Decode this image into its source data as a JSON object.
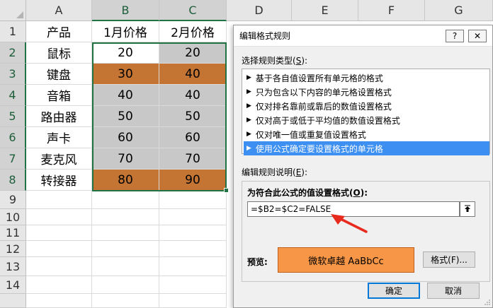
{
  "sheet": {
    "columns": [
      "A",
      "B",
      "C",
      "D",
      "E",
      "F",
      "G"
    ],
    "rows": [
      "1",
      "2",
      "3",
      "4",
      "5",
      "6",
      "7",
      "8",
      "9",
      "10",
      "11",
      "12",
      "13",
      "14"
    ],
    "header_row": [
      "产品",
      "1月价格",
      "2月价格"
    ],
    "data": [
      {
        "name": "鼠标",
        "jan": "20",
        "feb": "20"
      },
      {
        "name": "键盘",
        "jan": "30",
        "feb": "40"
      },
      {
        "name": "音箱",
        "jan": "40",
        "feb": "40"
      },
      {
        "name": "路由器",
        "jan": "50",
        "feb": "50"
      },
      {
        "name": "声卡",
        "jan": "60",
        "feb": "60"
      },
      {
        "name": "麦克风",
        "jan": "70",
        "feb": "70"
      },
      {
        "name": "转接器",
        "jan": "80",
        "feb": "90"
      }
    ],
    "colors": {
      "highlight": "#c47533",
      "selected": "#c8c8c8",
      "accent": "#217346"
    }
  },
  "dialog": {
    "title": "编辑格式规则",
    "help_label": "?",
    "close_label": "✕",
    "select_type_label": "选择规则类型(",
    "select_type_key": "S",
    "select_type_end": "):",
    "rule_types": [
      "基于各自值设置所有单元格的格式",
      "只为包含以下内容的单元格设置格式",
      "仅对排名靠前或靠后的数值设置格式",
      "仅对高于或低于平均值的数值设置格式",
      "仅对唯一值或重复值设置格式",
      "使用公式确定要设置格式的单元格"
    ],
    "selected_rule_index": 5,
    "edit_desc_label": "编辑规则说明(",
    "edit_desc_key": "E",
    "edit_desc_end": "):",
    "formula_label": "为符合此公式的值设置格式(",
    "formula_key": "O",
    "formula_end": "):",
    "formula_value": "=$B2=$C2=FALSE",
    "preview_label": "预览:",
    "preview_text": "微软卓越  AaBbCc",
    "preview_color": "#f79646",
    "format_button": "格式(F)...",
    "ok_button": "确定",
    "cancel_button": "取消"
  }
}
